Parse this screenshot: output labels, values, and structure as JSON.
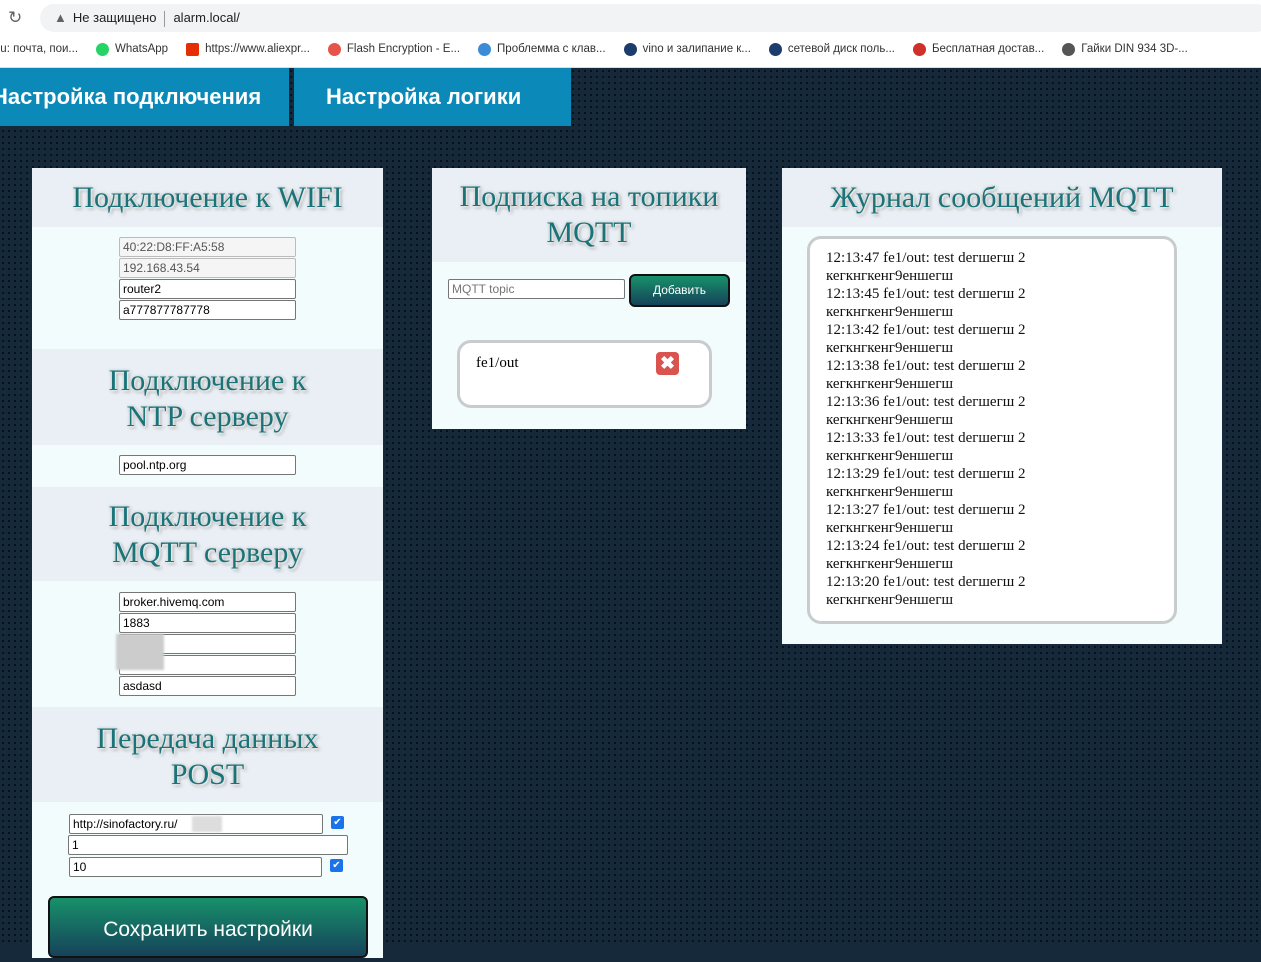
{
  "browser": {
    "security": "Не защищено",
    "url": "alarm.local/",
    "bookmarks": [
      "Ru: почта, пои...",
      "WhatsApp",
      "https://www.aliexpr...",
      "Flash Encryption - E...",
      "Проблемма с клав...",
      "vino и залипание к...",
      "сетевой диск поль...",
      "Бесплатная достав...",
      "Гайки DIN 934 3D-..."
    ]
  },
  "tabs": [
    "Настройка подключения",
    "Настройка логики"
  ],
  "settings": {
    "wifi": {
      "title": "Подключение к WIFI",
      "mac": "40:22:D8:FF:A5:58",
      "ip": "192.168.43.54",
      "ssid": "router2",
      "password": "a777877787778"
    },
    "ntp": {
      "title": "Подключение к NTP серверу",
      "server": "pool.ntp.org"
    },
    "mqtt": {
      "title": "Подключение к MQTT серверу",
      "host": "broker.hivemq.com",
      "port": "1883",
      "password": "asdasd"
    },
    "post": {
      "title": "Передача данных POST",
      "url": "http://sinofactory.ru/",
      "id": "1",
      "interval": "10",
      "url_enabled": true,
      "interval_enabled": true
    },
    "save_label": "Сохранить настройки"
  },
  "subscribe": {
    "title": "Подписка на топики MQTT",
    "placeholder": "MQTT topic",
    "add_label": "Добавить",
    "topics": [
      "fe1/out"
    ]
  },
  "journal": {
    "title": "Журнал сообщений MQTT",
    "messages": [
      "12:13:47 fe1/out: test dегшегш 2 кегкнгкенг9еншегш",
      "12:13:45 fe1/out: test dегшегш 2 кегкнгкенг9еншегш",
      "12:13:42 fe1/out: test dегшегш 2 кегкнгкенг9еншегш",
      "12:13:38 fe1/out: test dегшегш 2 кегкнгкенг9еншегш",
      "12:13:36 fe1/out: test dегшегш 2 кегкнгкенг9еншегш",
      "12:13:33 fe1/out: test dегшегш 2 кегкнгкенг9еншегш",
      "12:13:29 fe1/out: test dегшегш 2 кегкнгкенг9еншегш",
      "12:13:27 fe1/out: test dегшегш 2 кегкнгкенг9еншегш",
      "12:13:24 fe1/out: test dегшегш 2 кегкнгкенг9еншегш",
      "12:13:20 fe1/out: test dегшегш 2 кегкнгкенг9еншегш"
    ]
  }
}
